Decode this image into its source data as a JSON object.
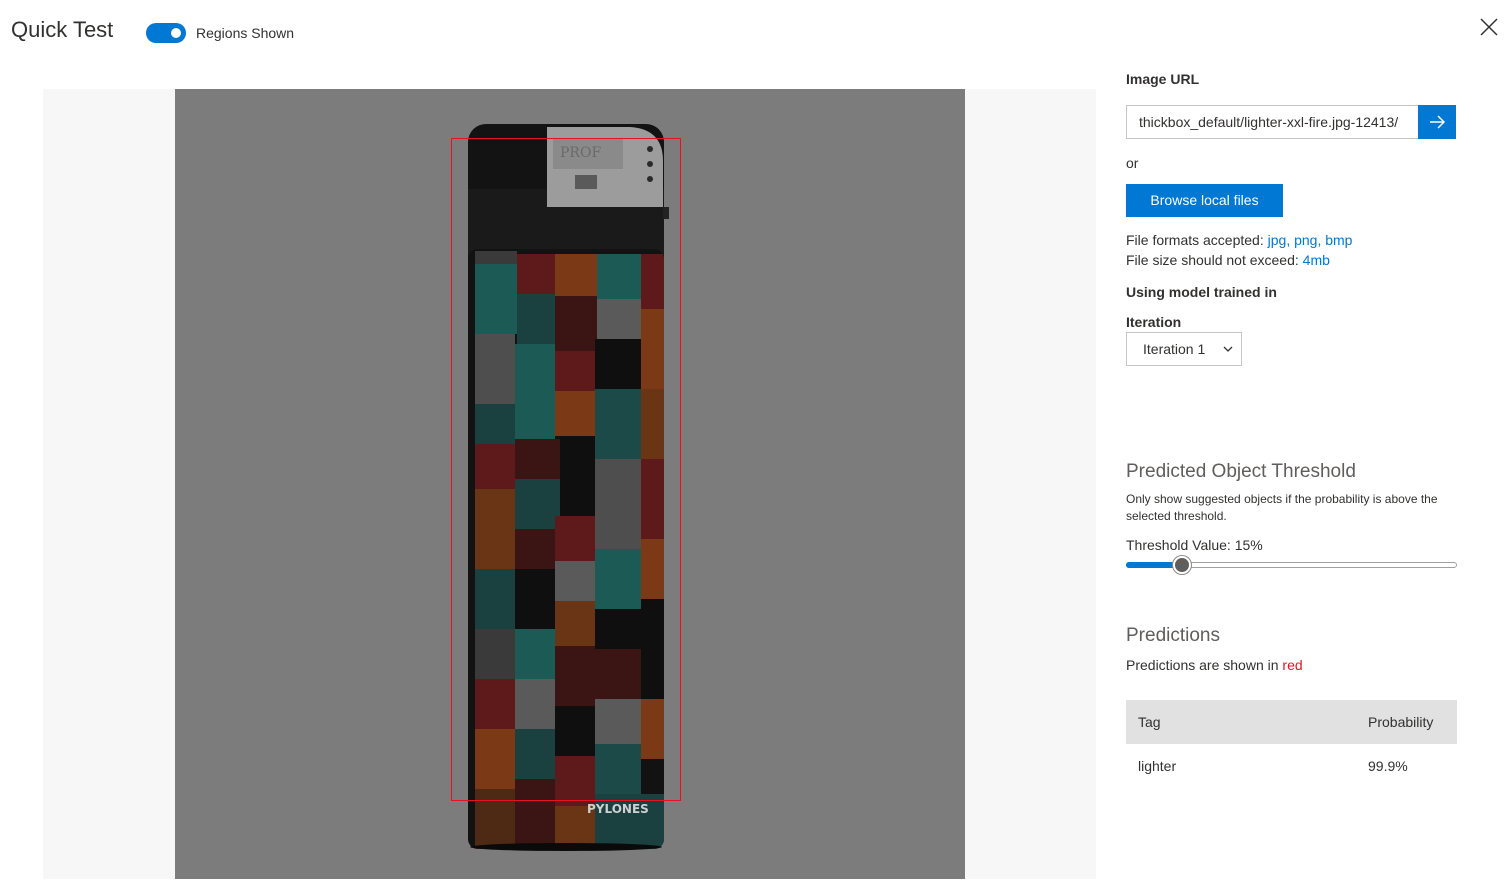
{
  "header": {
    "title": "Quick Test",
    "regions_toggle": {
      "label": "Regions Shown",
      "on": true
    }
  },
  "panel": {
    "image_url_label": "Image URL",
    "image_url_value": "/12413-thickbox_default/lighter-xxl-fire.jpg",
    "or_text": "or",
    "browse_button": "Browse local files",
    "formats_prefix": "File formats accepted:",
    "formats": [
      "jpg",
      "png",
      "bmp"
    ],
    "size_prefix": "File size should not exceed:",
    "size_value": "4mb",
    "model_label": "Using model trained in",
    "iteration_label": "Iteration",
    "iteration_selected": "Iteration 1",
    "threshold_title": "Predicted Object Threshold",
    "threshold_desc": "Only show suggested objects if the probability is above the selected threshold.",
    "threshold_label": "Threshold Value: 15%",
    "threshold_value": 0.15,
    "predictions_title": "Predictions",
    "predictions_note_prefix": "Predictions are shown in",
    "predictions_note_color_word": "red",
    "table": {
      "headers": {
        "tag": "Tag",
        "probability": "Probability"
      },
      "rows": [
        {
          "tag": "lighter",
          "probability": "99.9%"
        }
      ]
    }
  },
  "image": {
    "brand_text": "PYLONES",
    "cap_text": "PROF"
  },
  "colors": {
    "accent": "#0078d4",
    "prediction": "#e81123"
  }
}
